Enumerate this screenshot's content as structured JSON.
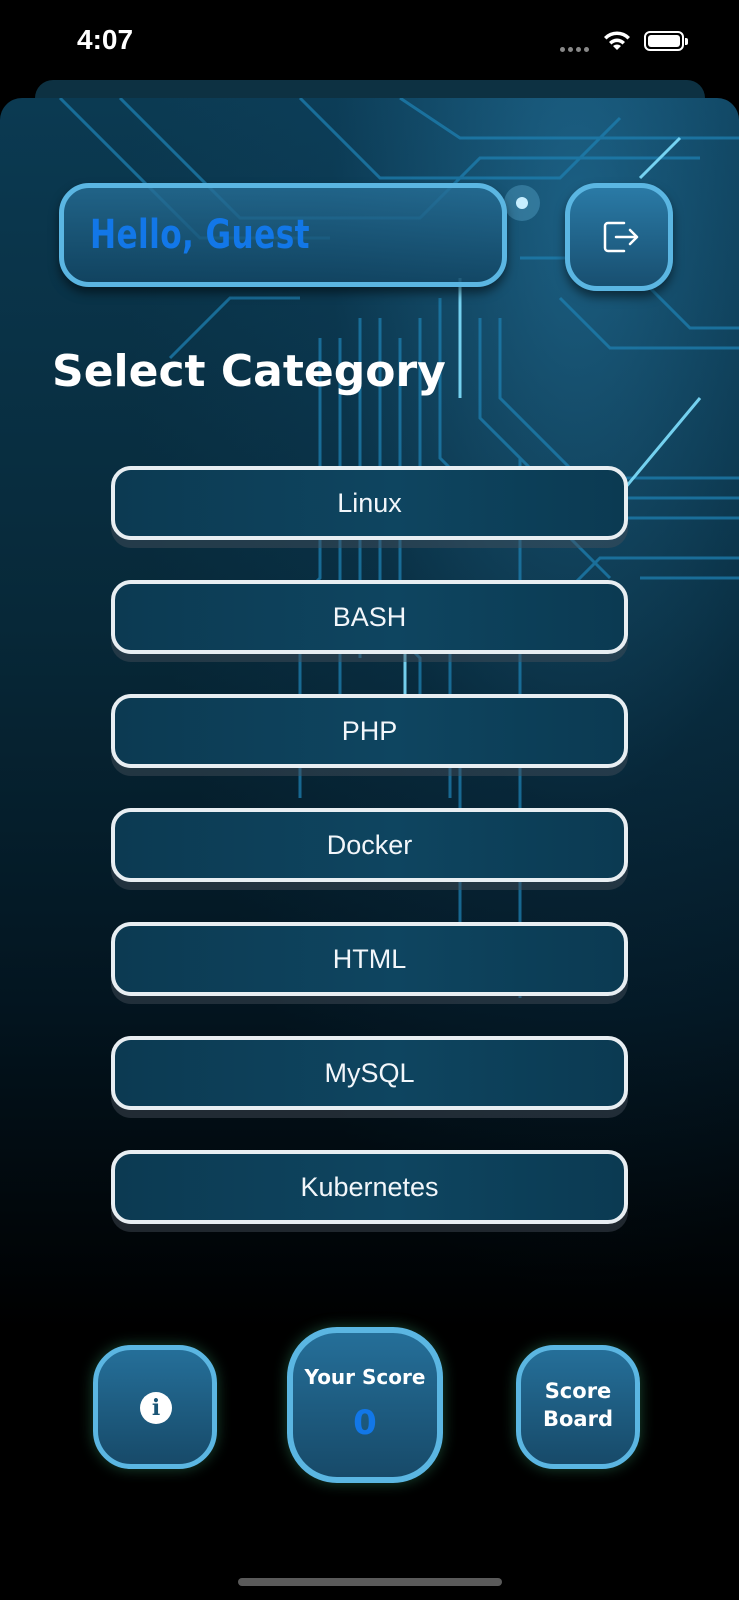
{
  "status_bar": {
    "time": "4:07"
  },
  "header": {
    "greeting": "Hello, Guest"
  },
  "main": {
    "title": "Select Category",
    "categories": [
      "Linux",
      "BASH",
      "PHP",
      "Docker",
      "HTML",
      "MySQL",
      "Kubernetes"
    ]
  },
  "bottom": {
    "score_label": "Your Score",
    "score_value": "0",
    "scoreboard_line1": "Score",
    "scoreboard_line2": "Board"
  },
  "colors": {
    "accent_border": "#5bb6e2",
    "greeting_text": "#1277e8",
    "score_value": "#1277e8"
  },
  "icons": [
    "wifi-icon",
    "battery-icon",
    "logout-icon",
    "info-icon"
  ]
}
